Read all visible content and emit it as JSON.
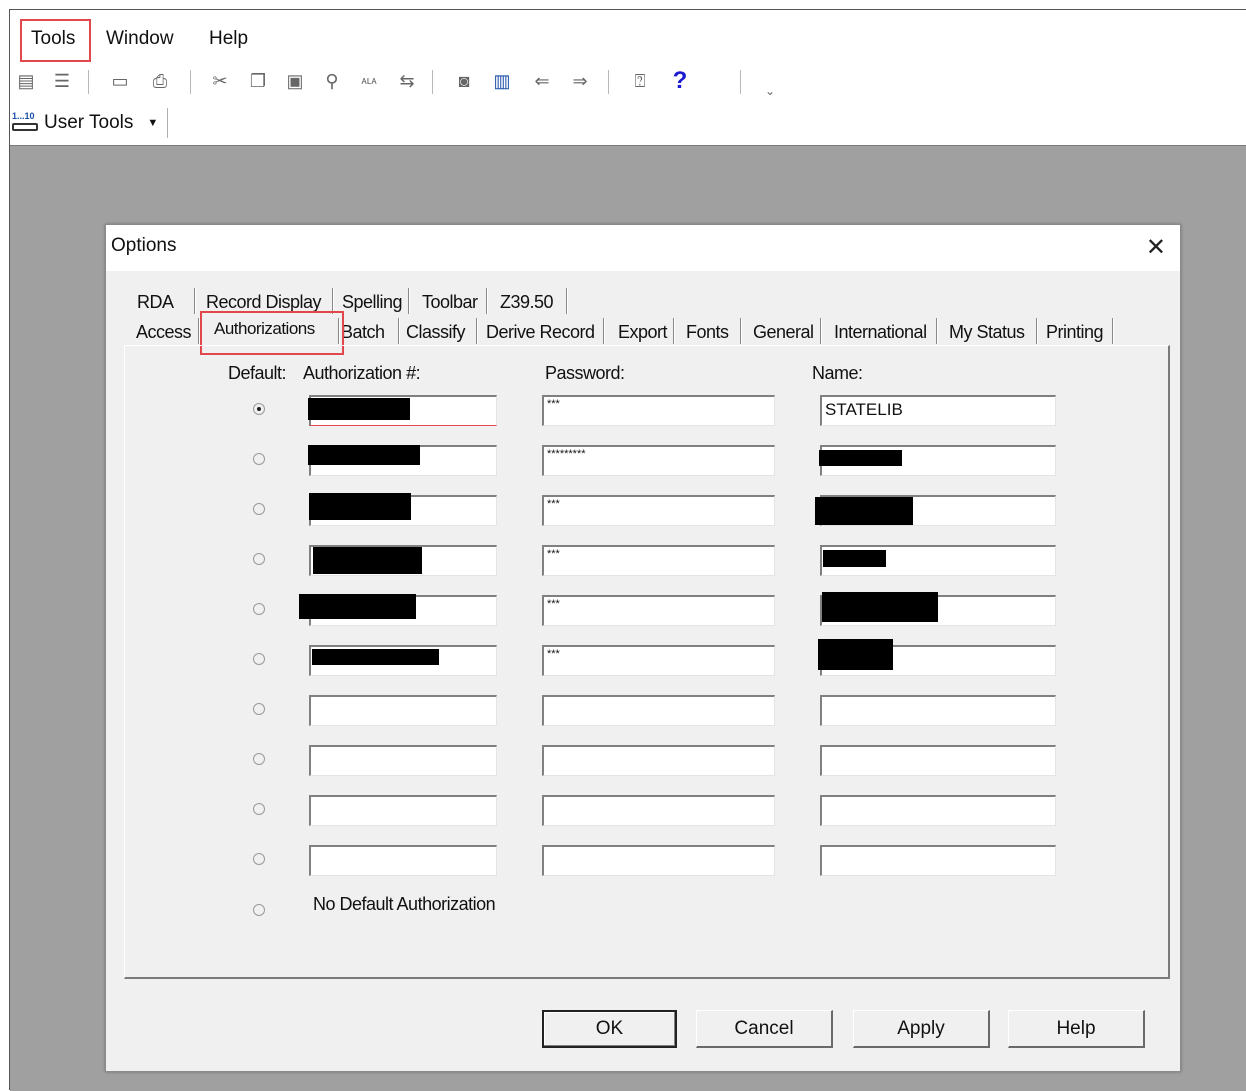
{
  "menubar": {
    "tools": "Tools",
    "window": "Window",
    "help": "Help"
  },
  "toolbar": {
    "user_tools_label": "User Tools",
    "user_tools_badge": "1...10",
    "icons": [
      "record-icon",
      "list-icon",
      "label-icon",
      "print-icon",
      "cut-icon",
      "copy-icon",
      "paste-icon",
      "find-icon",
      "ala-icon",
      "replace-icon",
      "stop-icon",
      "book-icon",
      "back-icon",
      "forward-icon",
      "context-help-icon",
      "help-icon",
      "more-icon"
    ]
  },
  "dialog": {
    "title": "Options",
    "close": "✕",
    "tabs_row1": [
      "RDA",
      "Record Display",
      "Spelling",
      "Toolbar",
      "Z39.50"
    ],
    "tabs_row2": [
      "Access",
      "Authorizations",
      "Batch",
      "Classify",
      "Derive Record",
      "Export",
      "Fonts",
      "General",
      "International",
      "My Status",
      "Printing"
    ],
    "active_tab": "Authorizations",
    "headers": {
      "default": "Default:",
      "auth": "Authorization #:",
      "password": "Password:",
      "name": "Name:"
    },
    "rows": [
      {
        "selected": true,
        "auth": "",
        "password": "***",
        "name": "STATELIB"
      },
      {
        "selected": false,
        "auth": "",
        "password": "*********",
        "name": ""
      },
      {
        "selected": false,
        "auth": "",
        "password": "***",
        "name": ""
      },
      {
        "selected": false,
        "auth": "",
        "password": "***",
        "name": ""
      },
      {
        "selected": false,
        "auth": "",
        "password": "***",
        "name": ""
      },
      {
        "selected": false,
        "auth": "",
        "password": "***",
        "name": ""
      },
      {
        "selected": false,
        "auth": "",
        "password": "",
        "name": ""
      },
      {
        "selected": false,
        "auth": "",
        "password": "",
        "name": ""
      },
      {
        "selected": false,
        "auth": "",
        "password": "",
        "name": ""
      },
      {
        "selected": false,
        "auth": "",
        "password": "",
        "name": ""
      }
    ],
    "no_default_label": "No Default Authorization",
    "buttons": {
      "ok": "OK",
      "cancel": "Cancel",
      "apply": "Apply",
      "help": "Help"
    }
  }
}
